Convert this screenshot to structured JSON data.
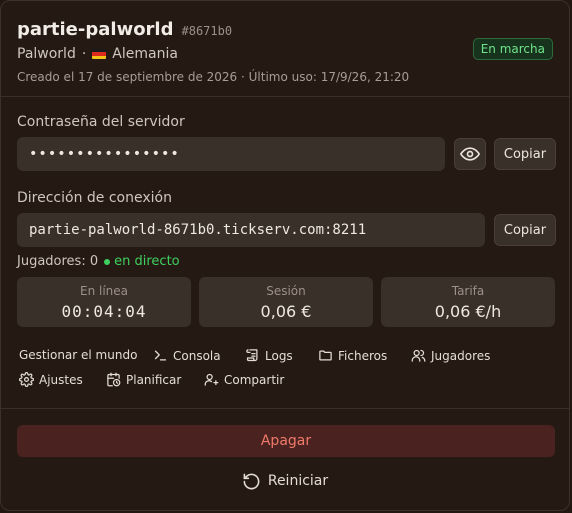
{
  "server": {
    "name": "partie-palworld",
    "hash": "#8671b0",
    "game": "Palworld",
    "country": "Alemania",
    "created_meta": "Creado el 17 de septiembre de 2026 · Último uso: 17/9/26, 21:20",
    "status": "En marcha"
  },
  "password": {
    "label": "Contraseña del servidor",
    "masked_value": "••••••••••••••••",
    "copy_label": "Copiar"
  },
  "connection": {
    "label": "Dirección de conexión",
    "address": "partie-palworld-8671b0.tickserv.com:8211",
    "copy_label": "Copiar"
  },
  "players": {
    "label": "Jugadores: 0",
    "live_label": "en directo"
  },
  "stats": [
    {
      "label": "En línea",
      "value": "00:04:04"
    },
    {
      "label": "Sesión",
      "value": "0,06 €"
    },
    {
      "label": "Tarifa",
      "value": "0,06 €/h"
    }
  ],
  "actions": [
    {
      "label": "Gestionar el mundo",
      "icon": "none"
    },
    {
      "label": "Consola",
      "icon": "terminal-icon"
    },
    {
      "label": "Logs",
      "icon": "logs-icon"
    },
    {
      "label": "Ficheros",
      "icon": "folder-icon"
    },
    {
      "label": "Jugadores",
      "icon": "users-icon"
    },
    {
      "label": "Ajustes",
      "icon": "gear-icon"
    },
    {
      "label": "Planificar",
      "icon": "calendar-clock-icon"
    },
    {
      "label": "Compartir",
      "icon": "user-plus-icon"
    }
  ],
  "footer": {
    "stop_label": "Apagar",
    "restart_label": "Reiniciar"
  },
  "colors": {
    "background": "#241a13",
    "status_green": "#6fe38a",
    "danger": "#f07a6a",
    "danger_bg": "#4a2320",
    "live_green": "#3fcf5e"
  }
}
